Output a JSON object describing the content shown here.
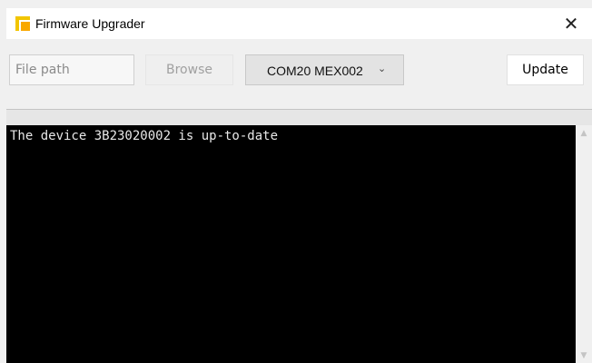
{
  "window": {
    "title": "Firmware Upgrader",
    "close_glyph": "✕",
    "app_icon": "app-logo-icon",
    "accent_yellow": "#f2c500",
    "accent_orange": "#f9a800"
  },
  "toolbar": {
    "file_path_placeholder": "File path",
    "file_path_value": "",
    "browse_label": "Browse",
    "port_selected": "COM20 MEX002",
    "port_chevron": "⌄",
    "update_label": "Update"
  },
  "progress": {
    "value": 0
  },
  "console": {
    "background": "#000000",
    "text_color": "#e8e8e8",
    "lines": [
      "The device 3B23020002 is up-to-date"
    ]
  },
  "scrollbar": {
    "up_glyph": "▲",
    "down_glyph": "▼"
  }
}
